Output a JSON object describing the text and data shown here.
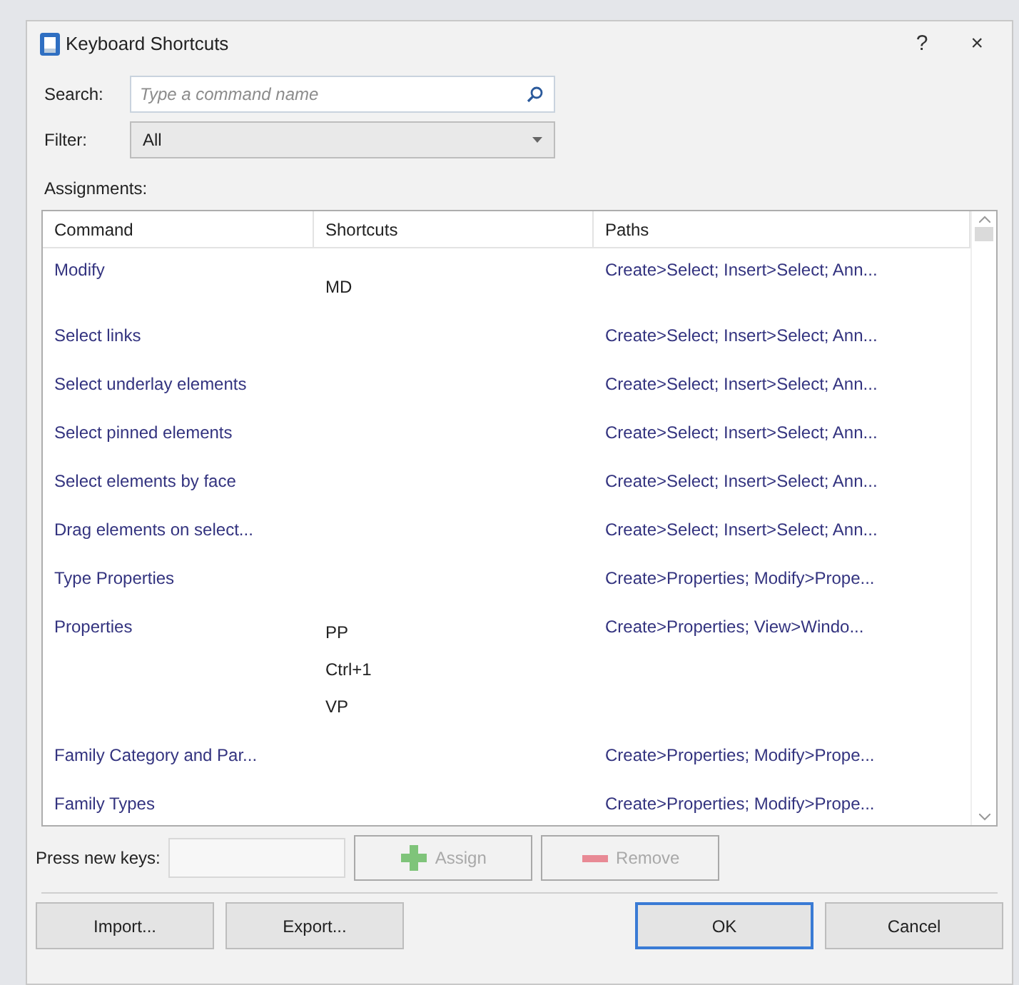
{
  "window": {
    "title": "Keyboard Shortcuts",
    "help": "?",
    "close": "×"
  },
  "search": {
    "label": "Search:",
    "placeholder": "Type a command name"
  },
  "filter": {
    "label": "Filter:",
    "value": "All"
  },
  "assignments": {
    "label": "Assignments:",
    "columns": [
      "Command",
      "Shortcuts",
      "Paths"
    ],
    "rows": [
      {
        "command": "Modify",
        "shortcuts": [
          "MD"
        ],
        "paths": "Create>Select; Insert>Select; Ann..."
      },
      {
        "command": "Select links",
        "shortcuts": [],
        "paths": "Create>Select; Insert>Select; Ann..."
      },
      {
        "command": "Select underlay elements",
        "shortcuts": [],
        "paths": "Create>Select; Insert>Select; Ann..."
      },
      {
        "command": "Select pinned elements",
        "shortcuts": [],
        "paths": "Create>Select; Insert>Select; Ann..."
      },
      {
        "command": "Select elements by face",
        "shortcuts": [],
        "paths": "Create>Select; Insert>Select; Ann..."
      },
      {
        "command": "Drag elements on select...",
        "shortcuts": [],
        "paths": "Create>Select; Insert>Select; Ann..."
      },
      {
        "command": "Type Properties",
        "shortcuts": [],
        "paths": "Create>Properties; Modify>Prope..."
      },
      {
        "command": "Properties",
        "shortcuts": [
          "PP",
          "Ctrl+1",
          "VP"
        ],
        "paths": "Create>Properties; View>Windo..."
      },
      {
        "command": "Family Category and Par...",
        "shortcuts": [],
        "paths": "Create>Properties; Modify>Prope..."
      },
      {
        "command": "Family Types",
        "shortcuts": [],
        "paths": "Create>Properties; Modify>Prope..."
      }
    ]
  },
  "new_keys": {
    "label": "Press new keys:",
    "assign": {
      "label": "Assign",
      "disabled": true
    },
    "remove": {
      "label": "Remove",
      "disabled": true
    }
  },
  "buttons": [
    {
      "label": "Import...",
      "default": false
    },
    {
      "label": "Export...",
      "default": false
    },
    {
      "label": "OK",
      "default": true
    },
    {
      "label": "Cancel",
      "default": false
    }
  ]
}
